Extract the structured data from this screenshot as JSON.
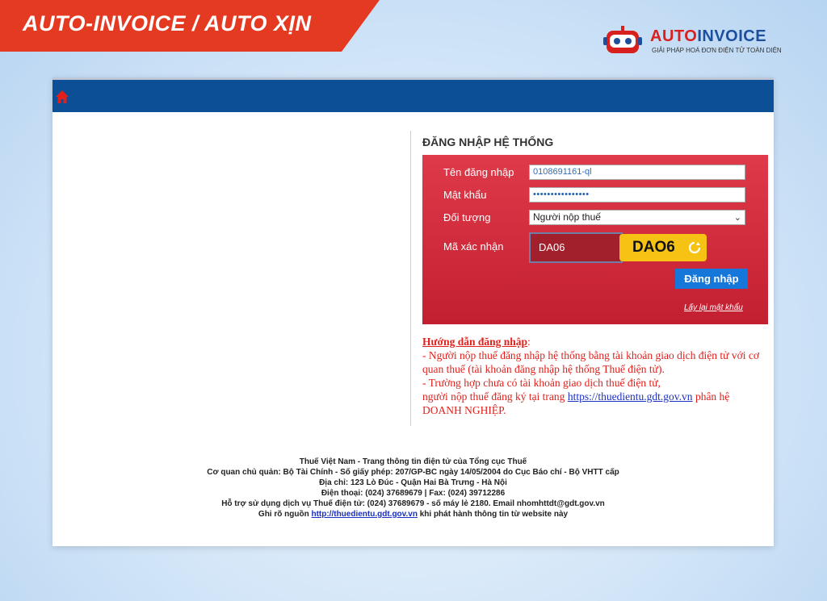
{
  "banner": {
    "text": "AUTO-INVOICE / AUTO XỊN"
  },
  "logo": {
    "title_a": "AUTO",
    "title_b": "INVOICE",
    "subtitle": "GIẢI PHÁP HOÁ ĐƠN ĐIỆN TỬ TOÀN DIỆN"
  },
  "login": {
    "title": "ĐĂNG NHẬP HỆ THỐNG",
    "username_label": "Tên đăng nhập",
    "username_value": "0108691161-ql",
    "password_label": "Mật khẩu",
    "password_value": "••••••••••••••••",
    "subject_label": "Đối tượng",
    "subject_value": "Người nộp thuế",
    "captcha_label": "Mã xác nhận",
    "captcha_input": "DA06",
    "captcha_image_text": "DAO6",
    "submit_label": "Đăng nhập",
    "forgot_label": "Lấy lại mật khẩu"
  },
  "guide": {
    "heading": "Hướng dẫn đăng nhập",
    "line1": "- Người nộp thuế đăng nhập hệ thống bằng tài khoản giao dịch điện tử với cơ quan thuế (tài khoản đăng nhập hệ thống Thuế điện tử).",
    "line2": "- Trường hợp chưa có tài khoản giao dịch thuế điện tử,",
    "line3_pre": "người nộp thuế đăng ký tại trang",
    "line3_link": "https://thuedientu.gdt.gov.vn",
    "line3_post": "phân hệ DOANH NGHIỆP."
  },
  "footer": {
    "line1": "Thuế Việt Nam - Trang thông tin điện tử của Tổng cục Thuế",
    "line2": "Cơ quan chủ quản: Bộ Tài Chính - Số giấy phép: 207/GP-BC ngày 14/05/2004 do Cục Báo chí - Bộ VHTT cấp",
    "line3": "Địa chỉ: 123 Lò Đúc - Quận Hai Bà Trưng - Hà Nội",
    "line4": "Điện thoại: (024) 37689679 | Fax: (024) 39712286",
    "line5": "Hỗ trợ sử dụng dịch vụ Thuế điện tử: (024) 37689679 - số máy lẻ 2180. Email nhomhttdt@gdt.gov.vn",
    "line6_pre": "Ghi rõ nguồn",
    "line6_link": "http://thuedientu.gdt.gov.vn",
    "line6_post": "khi phát hành thông tin từ website này"
  },
  "colors": {
    "banner": "#e53a22",
    "topbar": "#0d4f97",
    "login_box": "#d02c3c",
    "captcha_bg": "#f6c315",
    "button": "#1577d9",
    "guide_text": "#e0201c"
  }
}
